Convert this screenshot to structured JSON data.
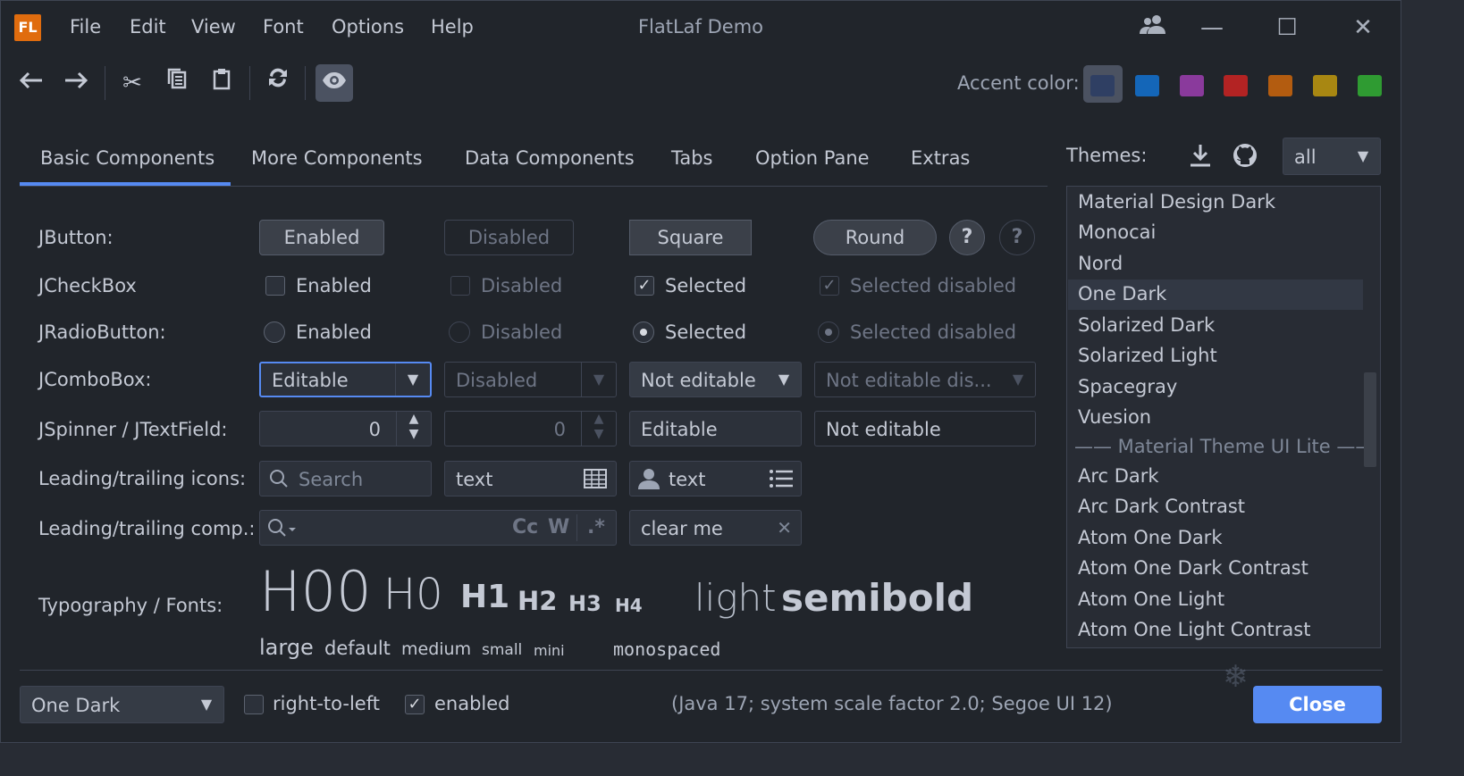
{
  "app": {
    "logo_text": "FL",
    "title": "FlatLaf Demo",
    "menu": [
      "File",
      "Edit",
      "View",
      "Font",
      "Options",
      "Help"
    ]
  },
  "toolbar": {
    "accent_label": "Accent color:",
    "accent_colors": [
      "#2f3f63",
      "#1466b8",
      "#8a3a9c",
      "#b32323",
      "#b35c10",
      "#a88712",
      "#2f9b32"
    ]
  },
  "tabs": [
    "Basic Components",
    "More Components",
    "Data Components",
    "Tabs",
    "Option Pane",
    "Extras"
  ],
  "rows": {
    "jbutton": {
      "label": "JButton:",
      "enabled": "Enabled",
      "disabled": "Disabled",
      "square": "Square",
      "round": "Round",
      "help": "?"
    },
    "jcheckbox": {
      "label": "JCheckBox",
      "enabled": "Enabled",
      "disabled": "Disabled",
      "selected": "Selected",
      "selected_disabled": "Selected disabled"
    },
    "jradio": {
      "label": "JRadioButton:",
      "enabled": "Enabled",
      "disabled": "Disabled",
      "selected": "Selected",
      "selected_disabled": "Selected disabled"
    },
    "jcombo": {
      "label": "JComboBox:",
      "editable": "Editable",
      "disabled": "Disabled",
      "not_editable": "Not editable",
      "not_editable_dis": "Not editable dis..."
    },
    "jspinner": {
      "label": "JSpinner / JTextField:",
      "spinner_value": "0",
      "spinner_disabled_value": "0",
      "editable": "Editable",
      "not_editable": "Not editable"
    },
    "icons": {
      "label": "Leading/trailing icons:",
      "search_placeholder": "Search",
      "text1": "text",
      "text2": "text"
    },
    "comp": {
      "label": "Leading/trailing comp.:",
      "match_case": "Cc",
      "whole_word": "W",
      "regex": ".*",
      "clear_text": "clear me"
    },
    "typography": {
      "label": "Typography / Fonts:",
      "h00": "H00",
      "h0": "H0",
      "h1": "H1",
      "h2": "H2",
      "h3": "H3",
      "h4": "H4",
      "light": "light",
      "semibold": "semibold",
      "large": "large",
      "default": "default",
      "medium": "medium",
      "small": "small",
      "mini": "mini",
      "monospaced": "monospaced"
    }
  },
  "themes": {
    "label": "Themes:",
    "filter": "all",
    "items": [
      "Material Design Dark",
      "Monocai",
      "Nord",
      "One Dark",
      "Solarized Dark",
      "Solarized Light",
      "Spacegray",
      "Vuesion"
    ],
    "header": "—— Material Theme UI Lite ——",
    "items2": [
      "Arc Dark",
      "Arc Dark Contrast",
      "Atom One Dark",
      "Atom One Dark Contrast",
      "Atom One Light",
      "Atom One Light Contrast"
    ],
    "selected": "One Dark"
  },
  "bottom": {
    "theme_combo": "One Dark",
    "rtl_label": "right-to-left",
    "enabled_label": "enabled",
    "status": "(Java 17;  system scale factor 2.0; Segoe UI 12)",
    "close": "Close"
  }
}
